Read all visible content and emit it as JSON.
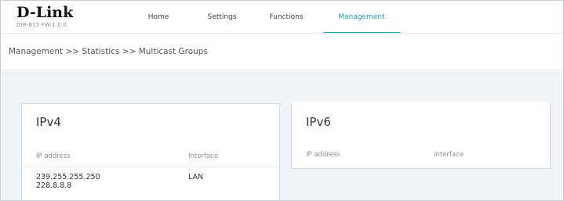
{
  "brand": {
    "name": "D-Link",
    "model": "DIR-615 FW:1.0.0"
  },
  "nav": {
    "items": [
      {
        "label": "Home"
      },
      {
        "label": "Settings"
      },
      {
        "label": "Functions"
      },
      {
        "label": "Management",
        "active": true
      }
    ]
  },
  "breadcrumb": "Management >> Statistics >> Multicast Groups",
  "ipv4": {
    "title": "IPv4",
    "columns": {
      "ip": "IP address",
      "interface": "Interface"
    },
    "rows": [
      {
        "ip_lines": [
          "239.255.255.250",
          "228.8.8.8"
        ],
        "interface": "LAN"
      }
    ]
  },
  "ipv6": {
    "title": "IPv6",
    "columns": {
      "ip": "IP address",
      "interface": "Interface"
    },
    "rows": []
  },
  "colors": {
    "accent": "#2aa0b6",
    "background": "#eef3f7"
  }
}
